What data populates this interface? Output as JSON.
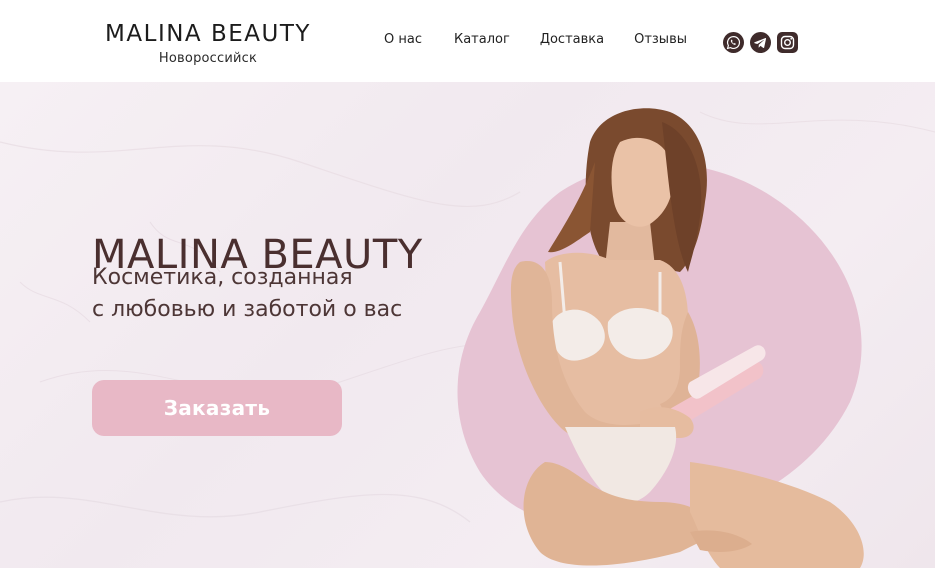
{
  "header": {
    "logo": "MALINA  BEAUTY",
    "city": "Новороссийск",
    "nav": [
      {
        "label": "О нас"
      },
      {
        "label": "Каталог"
      },
      {
        "label": "Доставка"
      },
      {
        "label": "Отзывы"
      }
    ],
    "socials": [
      {
        "icon": "whatsapp-icon"
      },
      {
        "icon": "telegram-icon"
      },
      {
        "icon": "instagram-icon"
      }
    ]
  },
  "hero": {
    "title": "MALINA BEAUTY",
    "subtitle_line1": "Косметика, созданная",
    "subtitle_line2": "с любовью и заботой о вас",
    "cta": "Заказать"
  },
  "colors": {
    "accent_pink": "#e8b8c6",
    "blob_pink": "#e6c3d3",
    "title_brown": "#4a2f2f",
    "social_dark": "#3f2b2b"
  }
}
